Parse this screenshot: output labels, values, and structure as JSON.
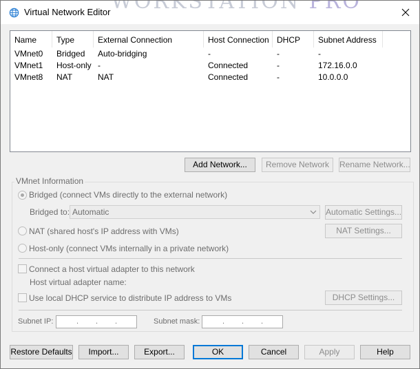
{
  "window": {
    "title": "Virtual Network Editor",
    "background_title_fragment_a": "WORKSTATION",
    "background_title_fragment_b": "PRO"
  },
  "table": {
    "columns": [
      "Name",
      "Type",
      "External Connection",
      "Host Connection",
      "DHCP",
      "Subnet Address"
    ],
    "rows": [
      [
        "VMnet0",
        "Bridged",
        "Auto-bridging",
        "-",
        "-",
        "-"
      ],
      [
        "VMnet1",
        "Host-only",
        "-",
        "Connected",
        "-",
        "172.16.0.0"
      ],
      [
        "VMnet8",
        "NAT",
        "NAT",
        "Connected",
        "-",
        "10.0.0.0"
      ]
    ]
  },
  "network_buttons": {
    "add": "Add Network...",
    "remove": "Remove Network",
    "rename": "Rename Network..."
  },
  "vmnet_info": {
    "group_label": "VMnet Information",
    "bridged_label": "Bridged (connect VMs directly to the external network)",
    "bridged_to_label": "Bridged to:",
    "bridged_to_value": "Automatic",
    "automatic_settings": "Automatic Settings...",
    "nat_label": "NAT (shared host's IP address with VMs)",
    "nat_settings": "NAT Settings...",
    "hostonly_label": "Host-only (connect VMs internally in a private network)",
    "connect_adapter_label": "Connect a host virtual adapter to this network",
    "adapter_name_label": "Host virtual adapter name:",
    "dhcp_label": "Use local DHCP service to distribute IP address to VMs",
    "dhcp_settings": "DHCP Settings...",
    "subnet_ip_label": "Subnet IP:",
    "subnet_mask_label": "Subnet mask:",
    "ip_dot": "."
  },
  "footer": {
    "restore": "Restore Defaults",
    "import": "Import...",
    "export": "Export...",
    "ok": "OK",
    "cancel": "Cancel",
    "apply": "Apply",
    "help": "Help"
  },
  "colors": {
    "accent": "#0078d7",
    "disabled_text": "#6d6d6d",
    "window_bg": "#f0f0f0"
  }
}
